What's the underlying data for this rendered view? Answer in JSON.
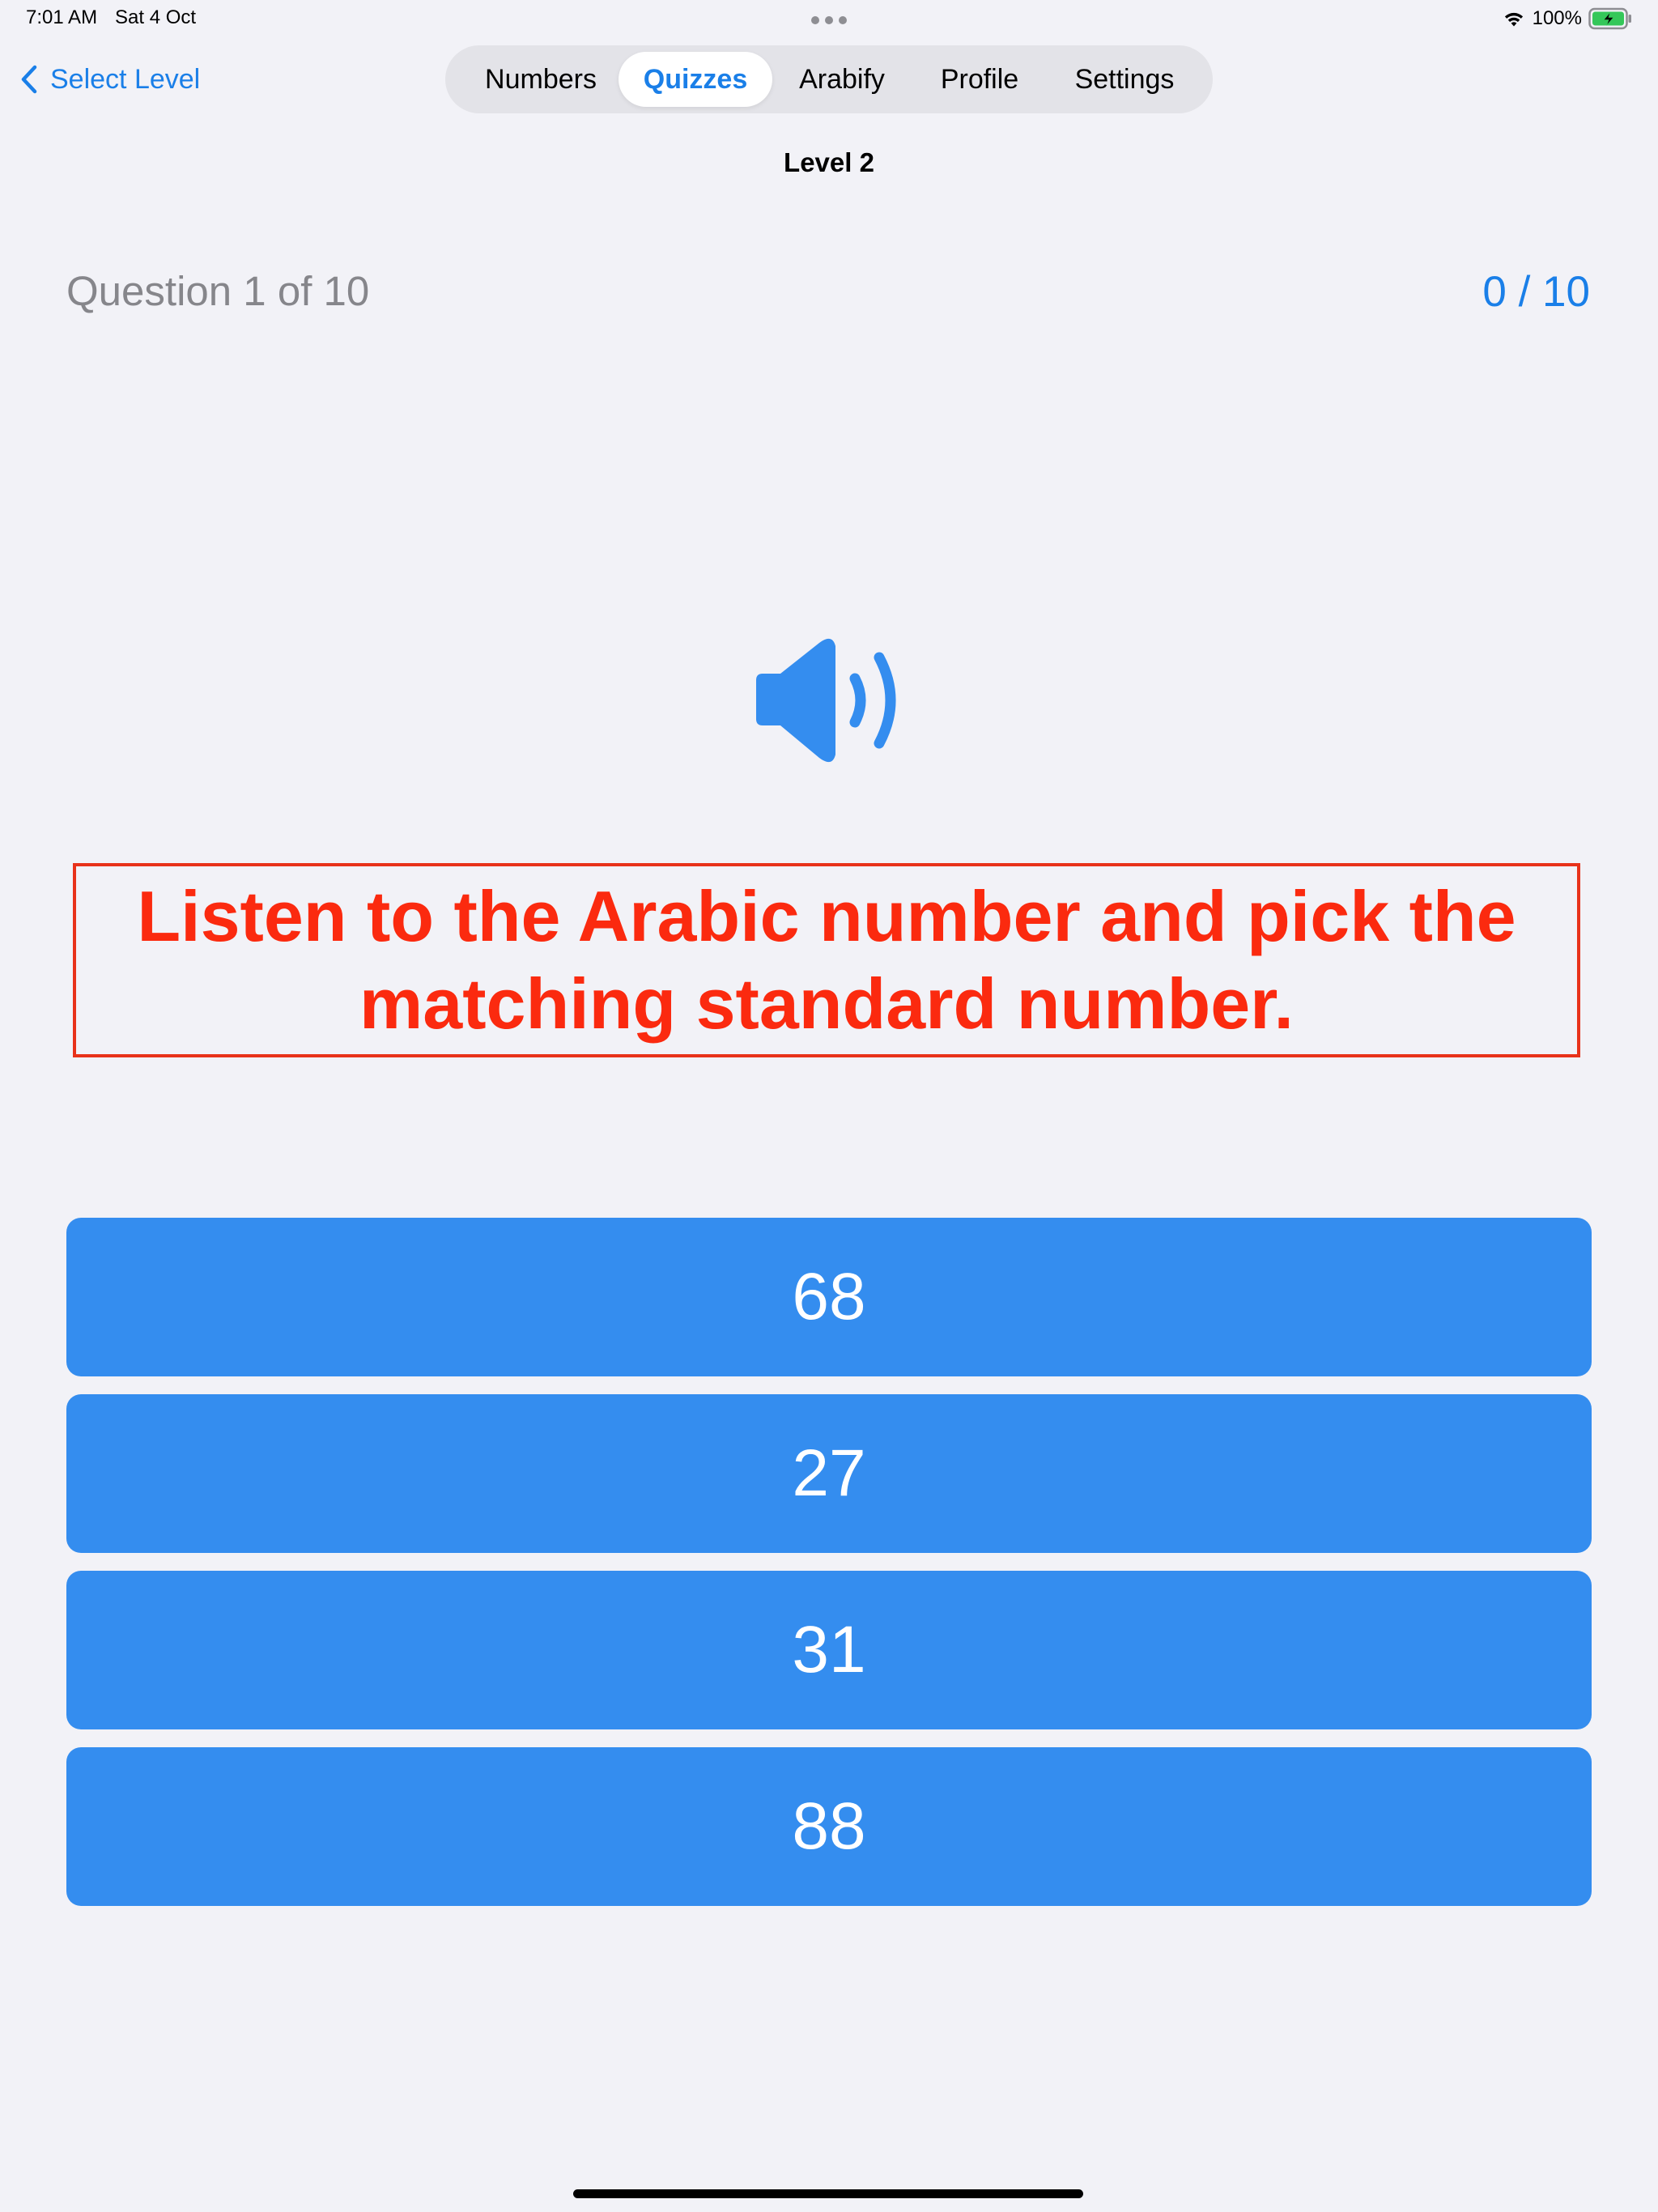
{
  "status_bar": {
    "time": "7:01 AM",
    "date": "Sat 4 Oct",
    "battery": "100%",
    "icons": [
      "wifi-icon",
      "battery-charging-icon",
      "multitask-dots-icon"
    ]
  },
  "nav": {
    "back_label": "Select Level",
    "back_icon": "chevron-left-icon",
    "tabs": [
      "Numbers",
      "Quizzes",
      "Arabify",
      "Profile",
      "Settings"
    ],
    "active_tab": "Quizzes"
  },
  "level_title": "Level 2",
  "quiz": {
    "question_label": "Question 1 of 10",
    "score": "0 / 10",
    "speaker_icon": "speaker-wave-icon",
    "instruction": "Listen to the Arabic number and pick the matching standard number.",
    "answers": [
      "68",
      "27",
      "31",
      "88"
    ]
  },
  "colors": {
    "accent": "#1a7fe8",
    "answer_bg": "#348def",
    "instruction": "#fb2a0f",
    "background": "#f2f2f7"
  }
}
